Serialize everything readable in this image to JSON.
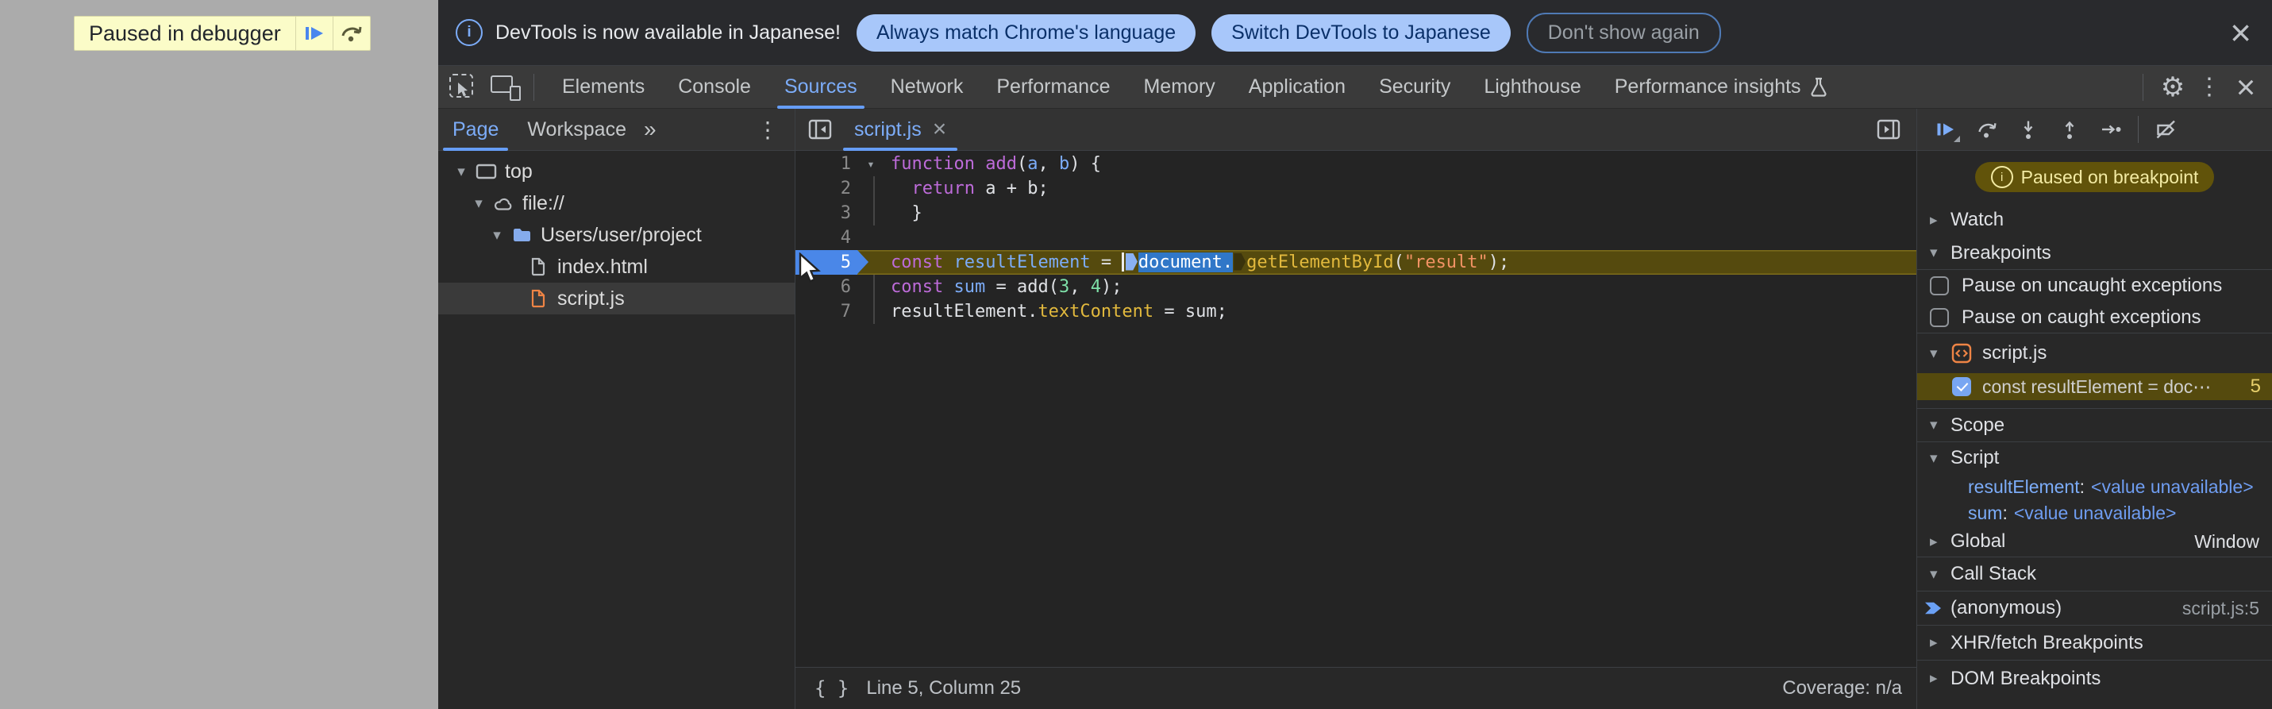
{
  "colors": {
    "accent_blue": "#7cacf8",
    "pill_bg": "#a8c7fa",
    "paused_badge_bg": "#61530a",
    "exec_line_bg": "#554a0e",
    "js_file_orange": "#ee8445",
    "page_dim_overlay": "#ababab"
  },
  "icons": {
    "more_tabs": "»",
    "overflow_menu": "⋮",
    "gear": "⚙",
    "close": "×",
    "info": "i",
    "fold_arrow": "▾",
    "pretty_print": "{ }"
  },
  "webpage": {
    "paused_label": "Paused in debugger"
  },
  "infobar": {
    "message": "DevTools is now available in Japanese!",
    "actions": [
      "Always match Chrome's language",
      "Switch DevTools to Japanese",
      "Don't show again"
    ]
  },
  "tabbar": {
    "tabs": [
      "Elements",
      "Console",
      "Sources",
      "Network",
      "Performance",
      "Memory",
      "Application",
      "Security",
      "Lighthouse",
      "Performance insights"
    ],
    "selected": "Sources",
    "flask_tab": "Performance insights"
  },
  "navigator": {
    "tabs": [
      "Page",
      "Workspace"
    ],
    "selected": "Page",
    "tree": [
      {
        "label": "top",
        "icon": "frame-icon",
        "depth": 0,
        "expanded": true
      },
      {
        "label": "file://",
        "icon": "cloud-icon",
        "depth": 1,
        "expanded": true
      },
      {
        "label": "Users/user/project",
        "icon": "folder-icon",
        "depth": 2,
        "expanded": true
      },
      {
        "label": "index.html",
        "icon": "file-html-icon",
        "depth": 3
      },
      {
        "label": "script.js",
        "icon": "file-js-icon",
        "depth": 3,
        "selected": true
      }
    ]
  },
  "editor": {
    "tab_label": "script.js",
    "lines": [
      {
        "num": 1,
        "fold": true,
        "tokens": [
          {
            "text": "function",
            "style": "kw"
          },
          {
            "text": " "
          },
          {
            "text": "add",
            "style": "kw"
          },
          {
            "text": "("
          },
          {
            "text": "a",
            "style": "def"
          },
          {
            "text": ", "
          },
          {
            "text": "b",
            "style": "def"
          },
          {
            "text": ") {"
          }
        ]
      },
      {
        "num": 2,
        "guide": true,
        "tokens": [
          {
            "text": "  "
          },
          {
            "text": "return",
            "style": "kw"
          },
          {
            "text": " a + b;"
          }
        ]
      },
      {
        "num": 3,
        "guide": true,
        "tokens": [
          {
            "text": "  }"
          }
        ]
      },
      {
        "num": 4,
        "tokens": []
      },
      {
        "num": 5,
        "exec": true,
        "tokens": [
          {
            "text": "const",
            "style": "kw"
          },
          {
            "text": " "
          },
          {
            "text": "resultElement",
            "style": "def"
          },
          {
            "text": " = "
          },
          {
            "widget": "caret"
          },
          {
            "widget": "marker",
            "variant": "blue"
          },
          {
            "text": "document.",
            "style": "sel"
          },
          {
            "widget": "marker",
            "variant": "dark"
          },
          {
            "text": "getElementById",
            "style": "prop"
          },
          {
            "text": "("
          },
          {
            "text": "\"result\"",
            "style": "str"
          },
          {
            "text": ");"
          }
        ]
      },
      {
        "num": 6,
        "guide": true,
        "tokens": [
          {
            "text": "const",
            "style": "kw"
          },
          {
            "text": " "
          },
          {
            "text": "sum",
            "style": "def"
          },
          {
            "text": " = add("
          },
          {
            "text": "3",
            "style": "num"
          },
          {
            "text": ", "
          },
          {
            "text": "4",
            "style": "num"
          },
          {
            "text": ");"
          }
        ]
      },
      {
        "num": 7,
        "guide": true,
        "tokens": [
          {
            "text": "resultElement."
          },
          {
            "text": "textContent",
            "style": "prop"
          },
          {
            "text": " = sum;"
          }
        ]
      }
    ],
    "status": {
      "position": "Line 5, Column 25",
      "coverage": "Coverage: n/a"
    }
  },
  "debugger": {
    "paused_badge": "Paused on breakpoint",
    "watch_label": "Watch",
    "breakpoints_label": "Breakpoints",
    "pause_uncaught": "Pause on uncaught exceptions",
    "pause_caught": "Pause on caught exceptions",
    "bp_file": "script.js",
    "bp_entry": {
      "label": "const resultElement = doc⋯",
      "line": "5",
      "enabled": true
    },
    "scope": {
      "title": "Scope",
      "script_label": "Script",
      "vars": [
        {
          "name": "resultElement",
          "value": "<value unavailable>"
        },
        {
          "name": "sum",
          "value": "<value unavailable>"
        }
      ],
      "global_label": "Global",
      "global_value": "Window"
    },
    "callstack": {
      "title": "Call Stack",
      "frames": [
        {
          "name": "(anonymous)",
          "location": "script.js:5",
          "active": true
        }
      ]
    },
    "xhr_label": "XHR/fetch Breakpoints",
    "dom_label": "DOM Breakpoints"
  }
}
